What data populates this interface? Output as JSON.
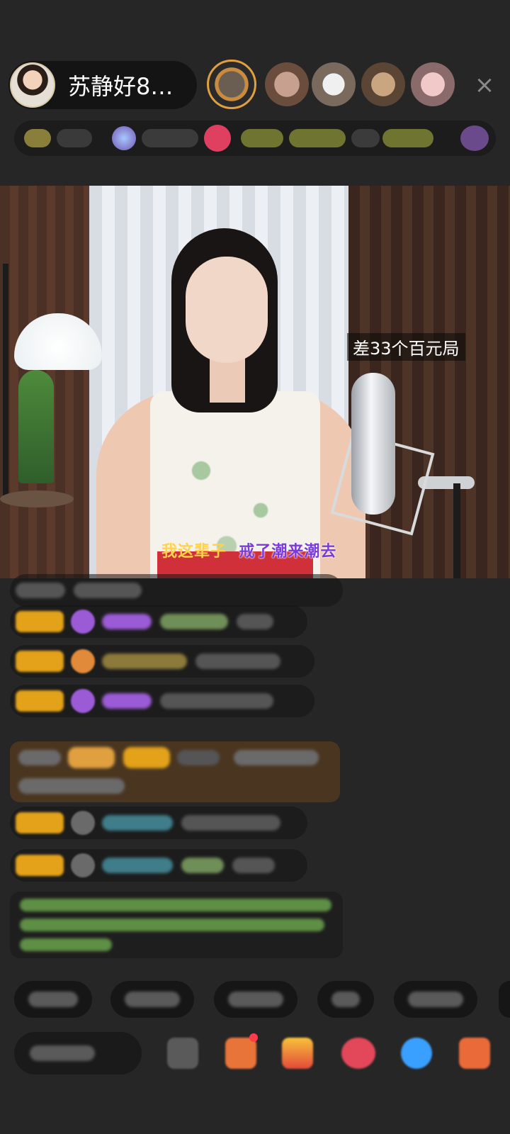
{
  "header": {
    "host_name": "苏静好8…",
    "close_icon": "×"
  },
  "video": {
    "pk_badge": "差33个百元局",
    "lyric_sung": "我这辈子",
    "lyric_rest": "  戒了潮来潮去"
  },
  "colors": {
    "background": "#262626",
    "level_badge": "#e3a21a",
    "lyric_sung": "#ffd24a",
    "lyric_rest": "#7a3bd6"
  }
}
